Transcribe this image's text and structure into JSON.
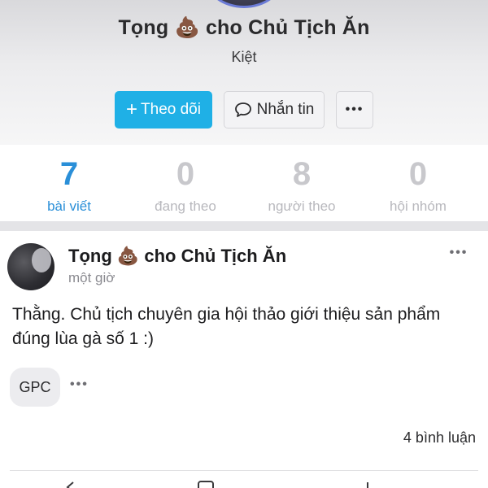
{
  "profile": {
    "name": "Tọng 💩 cho Chủ Tịch Ăn",
    "subtitle": "Kiệt",
    "follow_label": "Theo dõi",
    "follow_icon": "+",
    "message_label": "Nhắn tin",
    "more_label": "•••"
  },
  "stats": [
    {
      "value": "7",
      "label": "bài viết"
    },
    {
      "value": "0",
      "label": "đang theo"
    },
    {
      "value": "8",
      "label": "người theo"
    },
    {
      "value": "0",
      "label": "hội nhóm"
    }
  ],
  "post": {
    "author": "Tọng 💩 cho Chủ Tịch Ăn",
    "time": "một giờ",
    "menu_label": "•••",
    "body": "Thằng. Chủ tịch chuyên gia hội thảo giới thiệu sản phẩm đúng  lùa gà số 1 :)",
    "tag": "GPC",
    "tag_more": "•••",
    "comments": "4 bình luận"
  },
  "colors": {
    "accent": "#1fb0e6",
    "active_stat": "#2a8fd8",
    "inactive_stat": "#c8c8cc"
  },
  "icons": {
    "message": "chat-bubble-icon",
    "action_1": "share-icon",
    "action_2": "comment-icon",
    "action_3": "like-icon"
  }
}
